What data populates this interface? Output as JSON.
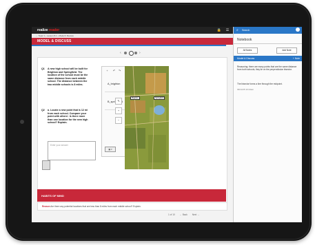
{
  "app": {
    "brand_main": "realize",
    "brand_accent": "reader",
    "breadcrumb": "← Topic 1 › Lesson 8-1 › Model It Review",
    "lesson_title": "MODEL & DISCUSS"
  },
  "colors": {
    "primary_red": "#c8283a",
    "accent_blue": "#2a77c7"
  },
  "questions": [
    {
      "number": "Q1",
      "text": "A new high school will be built for Brighton and Springfield. The location of the school must be the same distance from each middle school. The distance between the two middle schools is 8 miles."
    },
    {
      "number": "Q2",
      "text": "a. Locate a new point that is 12 mi from each school. Compare your point with others'. Is there more than one location for the new high school? Explain."
    }
  ],
  "answer_placeholder": "Enter your answer",
  "gadget": {
    "rows": [
      {
        "label": "A_brighton"
      },
      {
        "label": "B_springfield"
      }
    ],
    "footer": "▦ ▾"
  },
  "map": {
    "label_left": "Brighton",
    "label_right": "Springfield"
  },
  "habits": {
    "title": "HABITS OF MIND",
    "prompt_label": "Reason",
    "prompt_text": "Are there any potential locations that are less than 8 miles from each middle school? Explain."
  },
  "bottom_nav": {
    "page": "1 of 10",
    "back": "← Back",
    "next": "Next →"
  },
  "right_panel": {
    "search_label": "Search",
    "notebook_title": "Notebook",
    "btn_all": "All Notes",
    "btn_add": "Add Note",
    "section_title": "Model & Discuss",
    "section_link": "+ Note",
    "note_text": "Reasoning: there are many points that are the same distance from both schools; they lie on the perpendicular bisector.",
    "note_text2": "The bisector forms a line through the midpoint.",
    "note_date": "09/14/15 10:24am"
  }
}
